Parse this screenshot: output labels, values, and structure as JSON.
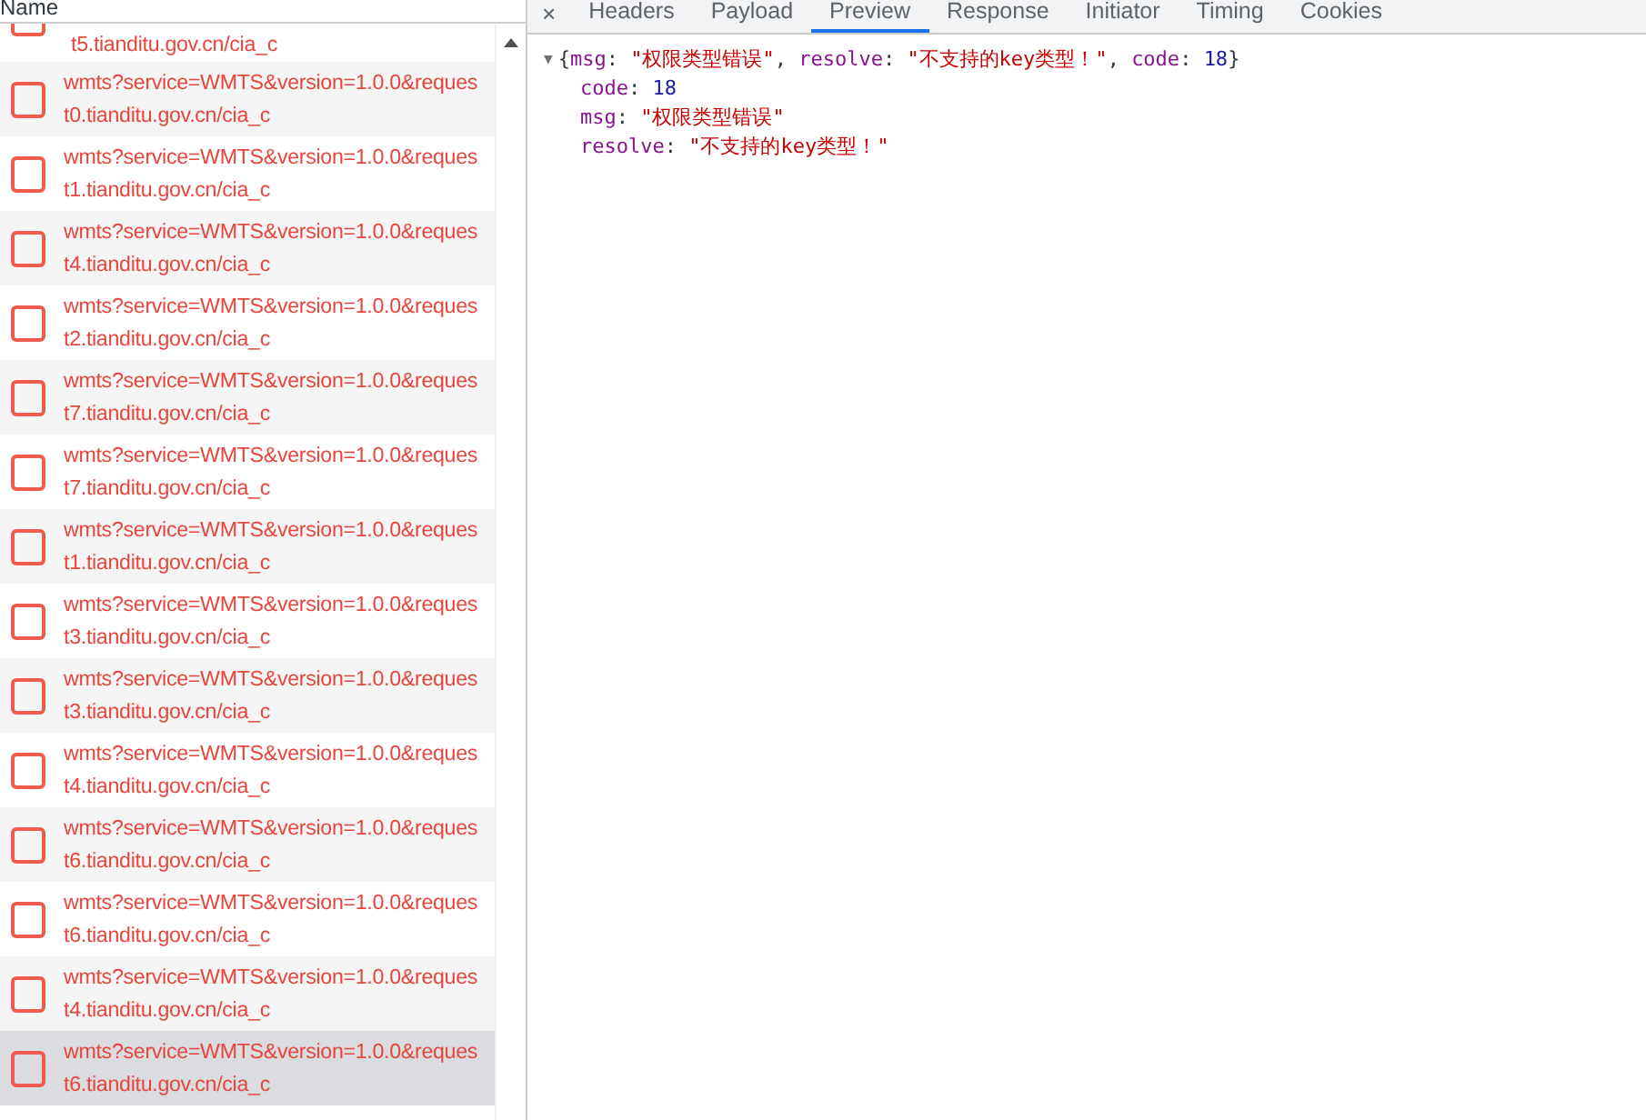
{
  "request_list": {
    "header": "Name",
    "top_partial_host": "t5.tianditu.gov.cn/cia_c",
    "rows": [
      {
        "name": "wmts?service=WMTS&version=1.0.0&reques",
        "host": "t0.tianditu.gov.cn/cia_c",
        "selected": false
      },
      {
        "name": "wmts?service=WMTS&version=1.0.0&reques",
        "host": "t1.tianditu.gov.cn/cia_c",
        "selected": false
      },
      {
        "name": "wmts?service=WMTS&version=1.0.0&reques",
        "host": "t4.tianditu.gov.cn/cia_c",
        "selected": false
      },
      {
        "name": "wmts?service=WMTS&version=1.0.0&reques",
        "host": "t2.tianditu.gov.cn/cia_c",
        "selected": false
      },
      {
        "name": "wmts?service=WMTS&version=1.0.0&reques",
        "host": "t7.tianditu.gov.cn/cia_c",
        "selected": false
      },
      {
        "name": "wmts?service=WMTS&version=1.0.0&reques",
        "host": "t7.tianditu.gov.cn/cia_c",
        "selected": false
      },
      {
        "name": "wmts?service=WMTS&version=1.0.0&reques",
        "host": "t1.tianditu.gov.cn/cia_c",
        "selected": false
      },
      {
        "name": "wmts?service=WMTS&version=1.0.0&reques",
        "host": "t3.tianditu.gov.cn/cia_c",
        "selected": false
      },
      {
        "name": "wmts?service=WMTS&version=1.0.0&reques",
        "host": "t3.tianditu.gov.cn/cia_c",
        "selected": false
      },
      {
        "name": "wmts?service=WMTS&version=1.0.0&reques",
        "host": "t4.tianditu.gov.cn/cia_c",
        "selected": false
      },
      {
        "name": "wmts?service=WMTS&version=1.0.0&reques",
        "host": "t6.tianditu.gov.cn/cia_c",
        "selected": false
      },
      {
        "name": "wmts?service=WMTS&version=1.0.0&reques",
        "host": "t6.tianditu.gov.cn/cia_c",
        "selected": false
      },
      {
        "name": "wmts?service=WMTS&version=1.0.0&reques",
        "host": "t4.tianditu.gov.cn/cia_c",
        "selected": false
      },
      {
        "name": "wmts?service=WMTS&version=1.0.0&reques",
        "host": "t6.tianditu.gov.cn/cia_c",
        "selected": true
      }
    ]
  },
  "tabs": [
    {
      "label": "Headers",
      "selected": false
    },
    {
      "label": "Payload",
      "selected": false
    },
    {
      "label": "Preview",
      "selected": true
    },
    {
      "label": "Response",
      "selected": false
    },
    {
      "label": "Initiator",
      "selected": false
    },
    {
      "label": "Timing",
      "selected": false
    },
    {
      "label": "Cookies",
      "selected": false
    }
  ],
  "close_symbol": "×",
  "preview": {
    "toggle": "▼",
    "summary": [
      {
        "kind": "punct",
        "text": "{"
      },
      {
        "kind": "key",
        "text": "msg"
      },
      {
        "kind": "punct",
        "text": ": "
      },
      {
        "kind": "string",
        "text": "\"权限类型错误\""
      },
      {
        "kind": "punct",
        "text": ", "
      },
      {
        "kind": "key",
        "text": "resolve"
      },
      {
        "kind": "punct",
        "text": ": "
      },
      {
        "kind": "string",
        "text": "\"不支持的key类型！\""
      },
      {
        "kind": "punct",
        "text": ", "
      },
      {
        "kind": "key",
        "text": "code"
      },
      {
        "kind": "punct",
        "text": ": "
      },
      {
        "kind": "number",
        "text": "18"
      },
      {
        "kind": "punct",
        "text": "}"
      }
    ],
    "separator": ": ",
    "properties": [
      {
        "key": "code",
        "kind": "number",
        "value": "18"
      },
      {
        "key": "msg",
        "kind": "string",
        "value": "\"权限类型错误\""
      },
      {
        "key": "resolve",
        "kind": "string",
        "value": "\"不支持的key类型！\""
      }
    ]
  }
}
